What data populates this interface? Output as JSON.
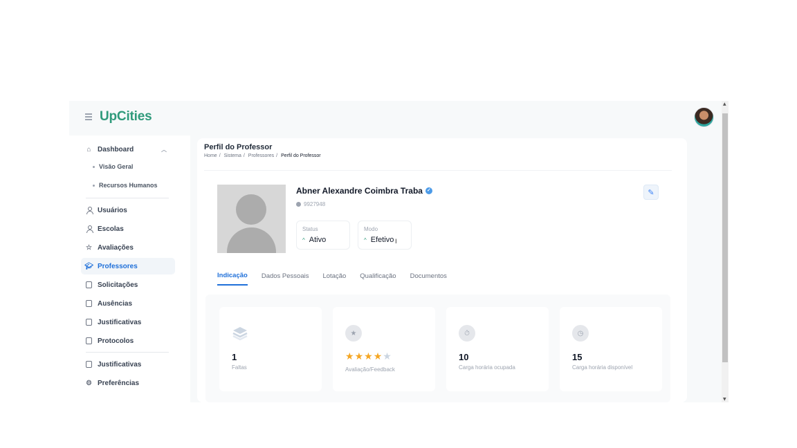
{
  "app": {
    "logo": "UpCities"
  },
  "sidebar": {
    "dashboard": "Dashboard",
    "sub_items": [
      "Visão Geral",
      "Recursos Humanos"
    ],
    "items": [
      "Usuários",
      "Escolas",
      "Avaliações",
      "Professores",
      "Solicitações",
      "Ausências",
      "Justificativas",
      "Protocolos"
    ],
    "bottom_items": [
      "Justificativas",
      "Preferências"
    ],
    "active": "Professores"
  },
  "page": {
    "title": "Perfil do Professor",
    "breadcrumb": [
      "Home",
      "Sistema",
      "Professores",
      "Perfil do Professor"
    ]
  },
  "profile": {
    "name": "Abner Alexandre Coimbra Traba",
    "id": "9927948",
    "status_label": "Status",
    "status_value": "Ativo",
    "mode_label": "Modo",
    "mode_value": "Efetivo"
  },
  "tabs": [
    "Indicação",
    "Dados Pessoais",
    "Lotação",
    "Qualificação",
    "Documentos"
  ],
  "indicators": [
    {
      "value": "1",
      "caption": "Faltas",
      "icon": "layers-icon"
    },
    {
      "value": "",
      "caption": "Avaliação/Feedback",
      "icon": "star-icon",
      "rating": 4,
      "max_rating": 5
    },
    {
      "value": "10",
      "caption": "Carga horária ocupada",
      "icon": "stopwatch-icon"
    },
    {
      "value": "15",
      "caption": "Carga horária disponível",
      "icon": "clock-icon"
    }
  ],
  "colors": {
    "brand": "#2f9a7b",
    "accent": "#1e6fd9",
    "star": "#f5a623"
  }
}
